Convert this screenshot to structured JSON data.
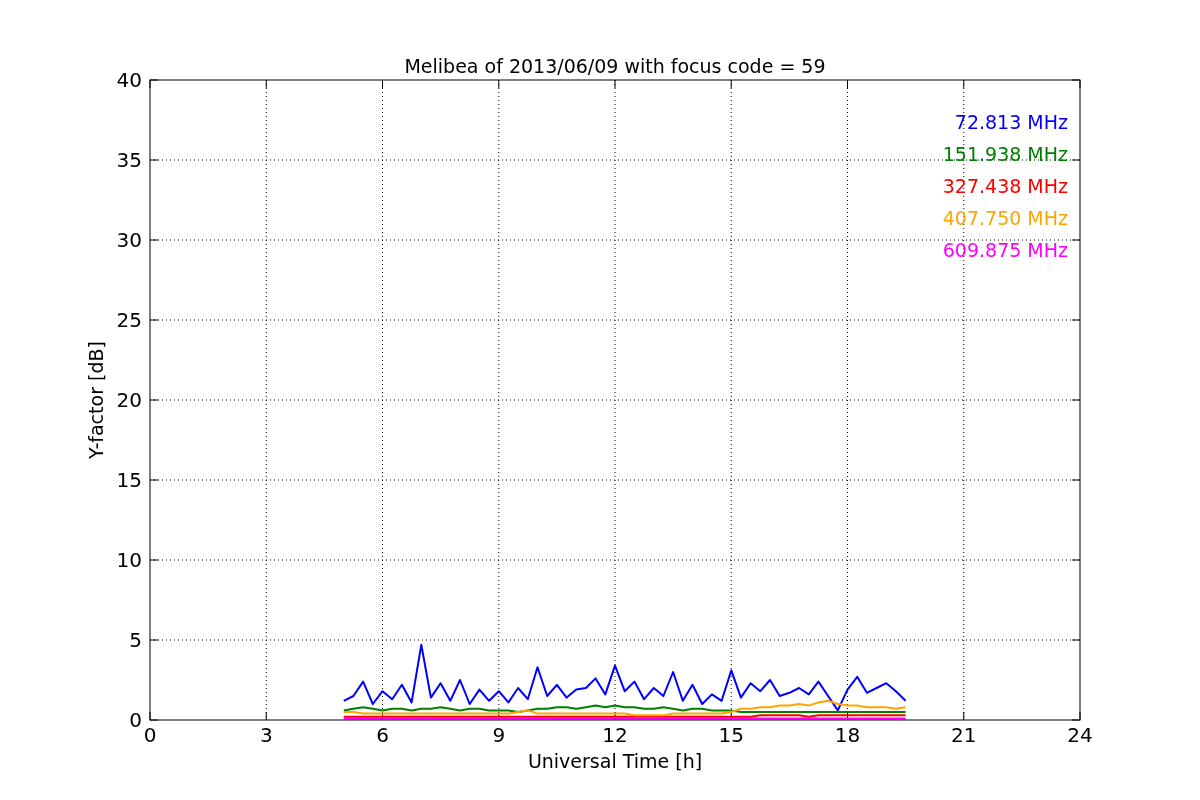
{
  "chart_data": {
    "type": "line",
    "grid": true,
    "title": "Melibea of 2013/06/09 with focus code = 59",
    "xlabel": "Universal Time [h]",
    "ylabel": "Y-factor [dB]",
    "xlim": [
      0,
      24
    ],
    "ylim": [
      0,
      40
    ],
    "xticks": [
      0,
      3,
      6,
      9,
      12,
      15,
      18,
      21,
      24
    ],
    "yticks": [
      0,
      5,
      10,
      15,
      20,
      25,
      30,
      35,
      40
    ],
    "x": [
      5,
      5.25,
      5.5,
      5.75,
      6,
      6.25,
      6.5,
      6.75,
      7,
      7.25,
      7.5,
      7.75,
      8,
      8.25,
      8.5,
      8.75,
      9,
      9.25,
      9.5,
      9.75,
      10,
      10.25,
      10.5,
      10.75,
      11,
      11.25,
      11.5,
      11.75,
      12,
      12.25,
      12.5,
      12.75,
      13,
      13.25,
      13.5,
      13.75,
      14,
      14.25,
      14.5,
      14.75,
      15,
      15.25,
      15.5,
      15.75,
      16,
      16.25,
      16.5,
      16.75,
      17,
      17.25,
      17.5,
      17.75,
      18,
      18.25,
      18.5,
      18.75,
      19,
      19.25,
      19.5
    ],
    "series": [
      {
        "name": "72.813 MHz",
        "color": "#0000ff",
        "values": [
          1.2,
          1.5,
          2.4,
          1.0,
          1.8,
          1.3,
          2.2,
          1.1,
          4.7,
          1.4,
          2.3,
          1.2,
          2.5,
          1.0,
          1.9,
          1.2,
          1.8,
          1.1,
          2.0,
          1.3,
          3.3,
          1.5,
          2.2,
          1.4,
          1.9,
          2.0,
          2.6,
          1.6,
          3.4,
          1.8,
          2.4,
          1.3,
          2.0,
          1.5,
          3.0,
          1.2,
          2.2,
          1.0,
          1.6,
          1.2,
          3.1,
          1.4,
          2.3,
          1.8,
          2.5,
          1.5,
          1.7,
          2.0,
          1.6,
          2.4,
          1.5,
          0.6,
          1.9,
          2.7,
          1.7,
          2.0,
          2.3,
          1.8,
          1.2
        ]
      },
      {
        "name": "151.938 MHz",
        "color": "#008000",
        "values": [
          0.6,
          0.7,
          0.8,
          0.7,
          0.6,
          0.7,
          0.7,
          0.6,
          0.7,
          0.7,
          0.8,
          0.7,
          0.6,
          0.7,
          0.7,
          0.6,
          0.6,
          0.6,
          0.5,
          0.6,
          0.7,
          0.7,
          0.8,
          0.8,
          0.7,
          0.8,
          0.9,
          0.8,
          0.9,
          0.8,
          0.8,
          0.7,
          0.7,
          0.8,
          0.7,
          0.6,
          0.7,
          0.7,
          0.6,
          0.6,
          0.6,
          0.5,
          0.5,
          0.5,
          0.5,
          0.5,
          0.5,
          0.5,
          0.5,
          0.5,
          0.5,
          0.5,
          0.5,
          0.5,
          0.5,
          0.5,
          0.5,
          0.5,
          0.5
        ]
      },
      {
        "name": "327.438 MHz",
        "color": "#ff0000",
        "values": [
          0.2,
          0.2,
          0.2,
          0.2,
          0.2,
          0.2,
          0.2,
          0.2,
          0.2,
          0.2,
          0.2,
          0.2,
          0.2,
          0.2,
          0.2,
          0.2,
          0.2,
          0.2,
          0.2,
          0.2,
          0.2,
          0.2,
          0.2,
          0.2,
          0.2,
          0.2,
          0.2,
          0.2,
          0.2,
          0.2,
          0.2,
          0.2,
          0.2,
          0.2,
          0.2,
          0.2,
          0.2,
          0.2,
          0.2,
          0.2,
          0.2,
          0.2,
          0.2,
          0.3,
          0.3,
          0.3,
          0.3,
          0.3,
          0.2,
          0.3,
          0.3,
          0.3,
          0.3,
          0.3,
          0.3,
          0.3,
          0.3,
          0.3,
          0.3
        ]
      },
      {
        "name": "407.750 MHz",
        "color": "#ffa500",
        "values": [
          0.5,
          0.5,
          0.4,
          0.4,
          0.4,
          0.4,
          0.4,
          0.4,
          0.4,
          0.4,
          0.4,
          0.4,
          0.4,
          0.4,
          0.4,
          0.4,
          0.4,
          0.4,
          0.5,
          0.6,
          0.4,
          0.4,
          0.4,
          0.4,
          0.4,
          0.4,
          0.4,
          0.4,
          0.4,
          0.4,
          0.3,
          0.3,
          0.3,
          0.3,
          0.4,
          0.4,
          0.4,
          0.4,
          0.4,
          0.4,
          0.5,
          0.7,
          0.7,
          0.8,
          0.8,
          0.9,
          0.9,
          1.0,
          0.9,
          1.1,
          1.2,
          1.0,
          0.9,
          0.9,
          0.8,
          0.8,
          0.8,
          0.7,
          0.8
        ]
      },
      {
        "name": "609.875 MHz",
        "color": "#ff00ff",
        "values": [
          0.1,
          0.1,
          0.1,
          0.1,
          0.1,
          0.1,
          0.1,
          0.1,
          0.1,
          0.1,
          0.1,
          0.1,
          0.1,
          0.1,
          0.1,
          0.1,
          0.1,
          0.1,
          0.1,
          0.1,
          0.1,
          0.1,
          0.1,
          0.1,
          0.1,
          0.1,
          0.1,
          0.1,
          0.1,
          0.1,
          0.1,
          0.1,
          0.1,
          0.1,
          0.1,
          0.1,
          0.1,
          0.1,
          0.1,
          0.1,
          0.1,
          0.1,
          0.1,
          0.1,
          0.1,
          0.1,
          0.1,
          0.1,
          0.1,
          0.1,
          0.1,
          0.1,
          0.1,
          0.1,
          0.1,
          0.1,
          0.1,
          0.1,
          0.1
        ]
      }
    ]
  }
}
